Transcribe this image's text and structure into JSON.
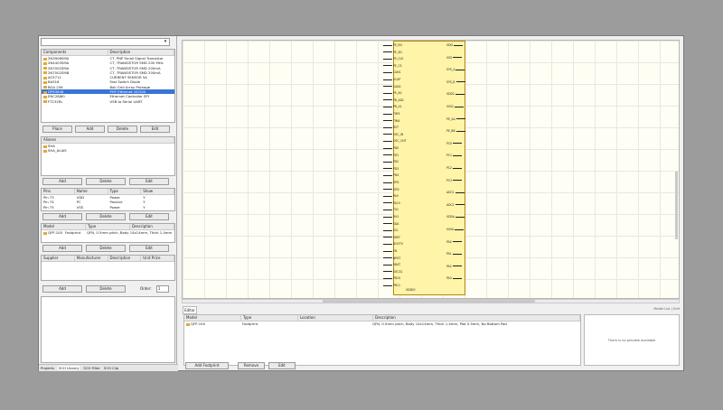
{
  "library": {
    "combo_value": "",
    "components_header": [
      "Components",
      "Description"
    ],
    "components": [
      {
        "name": "2N3906SMA",
        "desc": "CT, PNP Small Signal Transistor"
      },
      {
        "name": "2N4403SMA",
        "desc": "CT, TRANSISTOR SMD 200 MHz"
      },
      {
        "name": "2N7002SMA",
        "desc": "CT, TRANSISTOR SMD 200mA"
      },
      {
        "name": "2N7002SMB",
        "desc": "CT, TRANSISTOR SMD 200mA"
      },
      {
        "name": "ACS712",
        "desc": "CURRENT SENSOR 5A"
      },
      {
        "name": "BAS16",
        "desc": "Fast Switch Diode"
      },
      {
        "name": "BGA 256",
        "desc": "Ball Grid Array Package"
      },
      {
        "name": "DP83848",
        "desc": "PHY Ethernet 10/100"
      },
      {
        "name": "ENC28J60",
        "desc": "Ethernet Controller SPI"
      },
      {
        "name": "FT232RL",
        "desc": "USB to Serial UART"
      }
    ],
    "selected_index": 7,
    "comp_buttons": [
      "Place",
      "Add",
      "Delete",
      "Edit"
    ],
    "aliases_label": "Aliases",
    "aliases": [
      "SHA",
      "SHA_ALIAS"
    ],
    "alias_buttons": [
      "Add",
      "Delete",
      "Edit"
    ],
    "pins_header": [
      "Pins",
      "Name",
      "Type",
      "Show"
    ],
    "pins": [
      {
        "pin": "Pin 73",
        "name": "VDD",
        "type": "Power",
        "show": "Y"
      },
      {
        "pin": "Pin 74",
        "name": "PC",
        "type": "Passive",
        "show": "Y"
      },
      {
        "pin": "Pin 75",
        "name": "VSS",
        "type": "Power",
        "show": "Y"
      }
    ],
    "pin_buttons": [
      "Add",
      "Delete",
      "Edit"
    ],
    "models_header": [
      "Model",
      "Type",
      "Description"
    ],
    "models": [
      {
        "name": "QFP-100",
        "type": "Footprint",
        "desc": "QFN, 0.5mm pitch, Body 14x14mm, Thick 1.4mm"
      }
    ],
    "model_buttons": [
      "Add",
      "Delete",
      "Edit"
    ],
    "suppliers_header": [
      "Supplier",
      "Manufacturer",
      "Description",
      "Unit Price"
    ],
    "supplier_buttons": [
      "Add",
      "Delete"
    ],
    "order_label": "Order:",
    "order_value": "1",
    "status_items": [
      "Projects",
      "SCH Library",
      "SCH Filter",
      "SCH Clip"
    ]
  },
  "schematic": {
    "left_pins": [
      "PE_EN",
      "PE_SD",
      "PE_CLK",
      "PE_CS",
      "CAN1",
      "VCAP",
      "CAN2",
      "PE_A0",
      "PB_ADC",
      "PB_A1",
      "TIM3",
      "TIM4",
      "RST",
      "OSC_IN",
      "OSC_OUT",
      "PD0",
      "PD1",
      "PD2",
      "PD3",
      "PD4",
      "SPI1",
      "SPI2",
      "PA9",
      "PA10",
      "TX1",
      "RX1",
      "SDA",
      "SCL",
      "VREF",
      "BOOT0",
      "EN",
      "NRST",
      "VBAT",
      "OSC32",
      "PB10",
      "PB11"
    ],
    "right_pins": [
      "VDD",
      "VSS",
      "SYS_A",
      "SYS_B",
      "VDD2",
      "VSS2",
      "PE_AA",
      "PE_BB",
      "PC0",
      "PC1",
      "PC2",
      "PC3",
      "ADC1",
      "ADC2",
      "VDDA",
      "VSSA",
      "PA0",
      "PA1",
      "PA2",
      "PA3"
    ],
    "bottom_label": "VDDIO"
  },
  "editor": {
    "tab_label": "Editor",
    "right_links": "Model List | Edit",
    "grid_header": [
      "Model",
      "Type",
      "Location",
      "Description"
    ],
    "row": {
      "model": "QFP-100",
      "type": "Footprint",
      "location": "",
      "desc": "QFN, 0.5mm pitch, Body 14x14mm, Thick 1.4mm, Pad 0.3mm, No Bottom Pad"
    },
    "preview_text": "There is no preview available",
    "buttons": [
      "Add Footprint",
      "Remove",
      "Edit"
    ]
  }
}
